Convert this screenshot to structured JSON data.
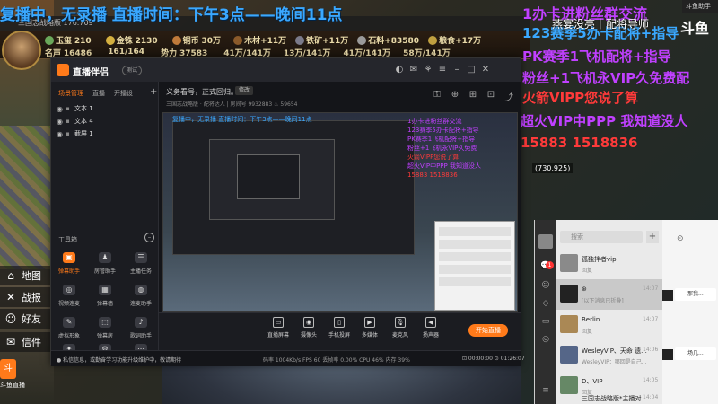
{
  "marquee": "复播中，无录播 直播时间：下午3点——晚间11点",
  "title_bar": "三国志战略版 176.709",
  "promos": [
    "1办卡进粉丝群交流",
    "123赛季5办卡配将+指导",
    "PK赛季1飞机配将+指导",
    "粉丝+1飞机永VIP久免费配",
    "火箭VIPP您说了算",
    "超火VIP中PPP 我知道没人",
    "15883 1518836"
  ],
  "top_right_title": "燕宴没亮｜配将导师",
  "douyu_r": "斗鱼",
  "right_title_bar": "斗鱼助手",
  "num_badge": "(730,925)",
  "game": {
    "row1": [
      {
        "label": "玉玺",
        "value": "210",
        "color": "#6aa85a"
      },
      {
        "label": "金铢",
        "value": "2130",
        "color": "#d4b040"
      },
      {
        "label": "铜币",
        "value": "30万",
        "color": "#c07a3a"
      },
      {
        "label": "木材+11万",
        "value": "",
        "color": "#8a5a2a"
      },
      {
        "label": "铁矿+11万",
        "value": "",
        "color": "#7a7a8a"
      },
      {
        "label": "石料+83580",
        "value": "",
        "color": "#9a9a9a"
      },
      {
        "label": "粮食+17万",
        "value": "",
        "color": "#c0a040"
      }
    ],
    "row2": [
      {
        "label": "名声",
        "value": "16486"
      },
      {
        "label": "",
        "value": "161/164"
      },
      {
        "label": "势力",
        "value": "37583"
      },
      {
        "label": "",
        "value": "41万/141万"
      },
      {
        "label": "",
        "value": "13万/141万"
      },
      {
        "label": "",
        "value": "41万/141万"
      },
      {
        "label": "",
        "value": "58万/141万"
      }
    ],
    "left_menu": [
      {
        "icon": "⌂",
        "label": "地图"
      },
      {
        "icon": "✕",
        "label": "战报"
      },
      {
        "icon": "☺",
        "label": "好友"
      },
      {
        "icon": "✉",
        "label": "信件"
      }
    ],
    "douyu_logo": "斗",
    "douyu_sub": "斗鱼直播"
  },
  "stream": {
    "app_name": "直播伴侣",
    "tag": "测试",
    "tabs": [
      "场景管理",
      "直播",
      "开播设"
    ],
    "scenes": [
      "文本 1",
      "文本 4",
      "截屏 1"
    ],
    "tools_label": "工具箱",
    "tools": [
      {
        "label": "弹幕助手",
        "icon": "▣",
        "active": true
      },
      {
        "label": "房管助手",
        "icon": "♟",
        "active": false
      },
      {
        "label": "主播任务",
        "icon": "☰",
        "active": false
      },
      {
        "label": "视频连麦",
        "icon": "◎",
        "active": false
      },
      {
        "label": "弹幕墙",
        "icon": "▦",
        "active": false
      },
      {
        "label": "连麦助手",
        "icon": "◍",
        "active": false
      },
      {
        "label": "虚拟形象",
        "icon": "✎",
        "active": false
      },
      {
        "label": "弹幕房",
        "icon": "⬚",
        "active": false
      },
      {
        "label": "歌词助手",
        "icon": "♪",
        "active": false
      },
      {
        "label": "自制",
        "icon": "✦",
        "active": false
      },
      {
        "label": "设置",
        "icon": "⚙",
        "active": false
      },
      {
        "label": "更多",
        "icon": "⋯",
        "active": false
      }
    ],
    "meta_title": "义务看号，正式回归。",
    "meta_edit": "修改",
    "meta_sub": "三国志战略版 · 配将达人 | 房间号 9932883  ♨ 59654",
    "bottom_tools": [
      {
        "label": "直播屏幕",
        "icon": "▭"
      },
      {
        "label": "摄像头",
        "icon": "◉"
      },
      {
        "label": "手机投屏",
        "icon": "▯"
      },
      {
        "label": "多媒体",
        "icon": "▶"
      },
      {
        "label": "麦克风",
        "icon": "🎙"
      },
      {
        "label": "扬声器",
        "icon": "◀"
      }
    ],
    "start_label": "开始直播",
    "status_left": "● 私信信息，或勤奋学习功能升级维护中，敬请期待",
    "status_mid": "码率 1004Kb/s   FPS 60   丢帧率 0.00%   CPU 46%   内存 39%",
    "status_right": "⊡ 00:00:00   ⊙ 01:26:07",
    "preview_red": [
      "复播中，无录播 直播时间：下午3点——晚间11点"
    ],
    "preview_promos": [
      "1办卡进粉丝群交流",
      "123赛季5办卡配将+指导",
      "PK赛季1飞机配将+指导",
      "粉丝+1飞机永VIP久免费",
      "火箭VIPP您说了算",
      "超火VIP中PPP 我知道没人",
      "15883 1518836"
    ]
  },
  "chat": {
    "search_placeholder": "搜索",
    "conversations": [
      {
        "name": "孤独拌者vip",
        "msg": "回复",
        "time": ""
      },
      {
        "name": "⊛",
        "msg": "[以下消息已折叠]",
        "time": "14:07"
      },
      {
        "name": "Berlin",
        "msg": "回复",
        "time": "14:07"
      },
      {
        "name": "WesleyVIP、天命 遗...",
        "msg": "WesleyVIP：哪回是自己...",
        "time": "14:06"
      },
      {
        "name": "D、VIP",
        "msg": "回复",
        "time": "14:05"
      },
      {
        "name": "三国志战略版*主播对...",
        "msg": "",
        "time": "14:04"
      }
    ],
    "bubble1": "那我...",
    "bubble2": "场几..."
  }
}
